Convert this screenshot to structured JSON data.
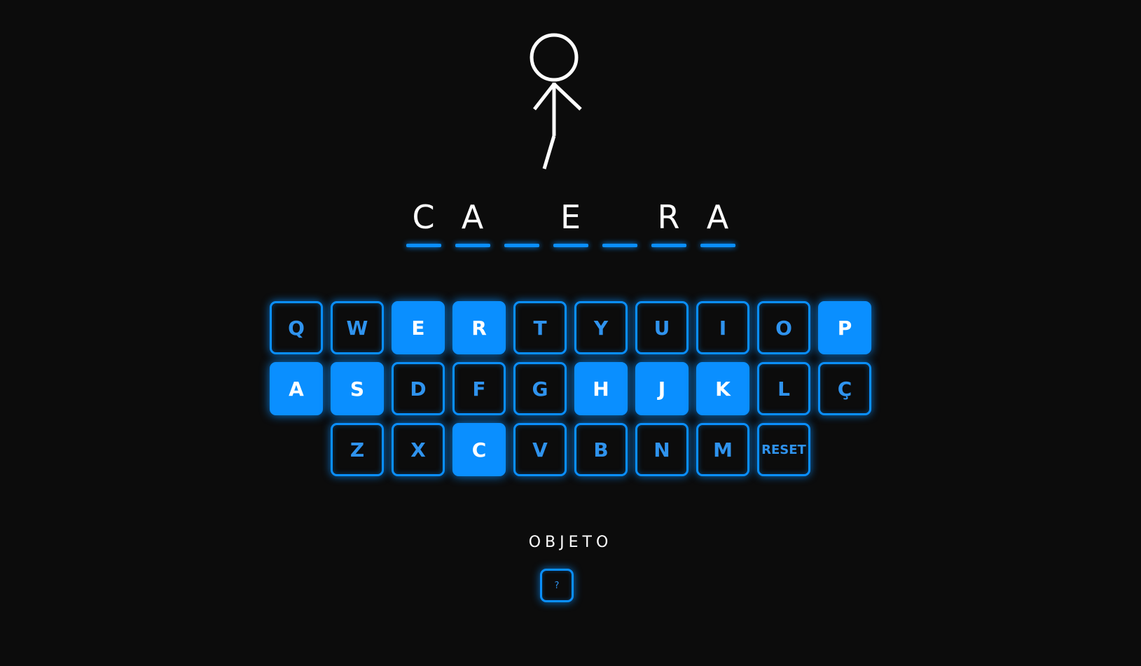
{
  "word": {
    "slots": [
      "C",
      "A",
      "",
      "E",
      "",
      "R",
      "A"
    ]
  },
  "keyboard": {
    "rows": [
      [
        {
          "label": "Q",
          "used": false
        },
        {
          "label": "W",
          "used": false
        },
        {
          "label": "E",
          "used": true
        },
        {
          "label": "R",
          "used": true
        },
        {
          "label": "T",
          "used": false
        },
        {
          "label": "Y",
          "used": false
        },
        {
          "label": "U",
          "used": false
        },
        {
          "label": "I",
          "used": false
        },
        {
          "label": "O",
          "used": false
        },
        {
          "label": "P",
          "used": true
        }
      ],
      [
        {
          "label": "A",
          "used": true
        },
        {
          "label": "S",
          "used": true
        },
        {
          "label": "D",
          "used": false
        },
        {
          "label": "F",
          "used": false
        },
        {
          "label": "G",
          "used": false
        },
        {
          "label": "H",
          "used": true
        },
        {
          "label": "J",
          "used": true
        },
        {
          "label": "K",
          "used": true
        },
        {
          "label": "L",
          "used": false
        },
        {
          "label": "Ç",
          "used": false
        }
      ],
      [
        {
          "label": "Z",
          "used": false
        },
        {
          "label": "X",
          "used": false
        },
        {
          "label": "C",
          "used": true
        },
        {
          "label": "V",
          "used": false
        },
        {
          "label": "B",
          "used": false
        },
        {
          "label": "N",
          "used": false
        },
        {
          "label": "M",
          "used": false
        },
        {
          "label": "RESET",
          "used": false,
          "reset": true
        }
      ]
    ]
  },
  "category": {
    "label": "OBJETO"
  },
  "hint": {
    "label": "?"
  },
  "colors": {
    "accent": "#0a8fff",
    "background": "#0c0c0c",
    "key_text": "#2f93ee",
    "figure": "#ffffff"
  },
  "hangman": {
    "parts_visible": [
      "head",
      "body",
      "left-arm",
      "right-arm",
      "left-leg"
    ]
  }
}
